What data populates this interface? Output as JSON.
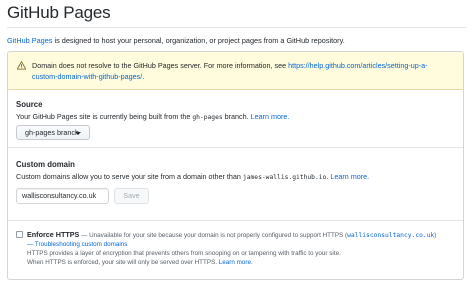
{
  "page": {
    "title": "GitHub Pages"
  },
  "intro": {
    "link": "GitHub Pages",
    "text": " is designed to host your personal, organization, or project pages from a GitHub repository."
  },
  "warning": {
    "icon": "alert-icon",
    "text": "Domain does not resolve to the GitHub Pages server. For more information, see ",
    "link_part1": "https://help.github.com/articles/setting-up-a-",
    "link_part2": "custom-domain-with-github-pages/",
    "after": "."
  },
  "source": {
    "heading": "Source",
    "desc_prefix": "Your GitHub Pages site is currently being built from the ",
    "branch_code": "gh-pages",
    "desc_suffix": " branch. ",
    "learn_more": "Learn more.",
    "branch_button": "gh-pages branch"
  },
  "custom_domain": {
    "heading": "Custom domain",
    "desc_prefix": "Custom domains allow you to serve your site from a domain other than ",
    "domain_code": "james-wallis.github.io",
    "desc_suffix": ". ",
    "learn_more": "Learn more.",
    "input_value": "wallisconsultancy.co.uk",
    "save_label": "Save"
  },
  "https": {
    "title": "Enforce HTTPS",
    "unavailable_prefix": " — Unavailable for your site because your domain is not properly configured to support HTTPS (",
    "unavailable_domain": "wallisconsultancy.co.uk",
    "unavailable_suffix": ")",
    "troubleshooting": "— Troubleshooting custom domains",
    "line3": "HTTPS provides a layer of encryption that prevents others from snooping on or tampering with traffic to your site.",
    "line4_prefix": "When HTTPS is enforced, your site will only be served over HTTPS. ",
    "learn_more": "Learn more."
  }
}
